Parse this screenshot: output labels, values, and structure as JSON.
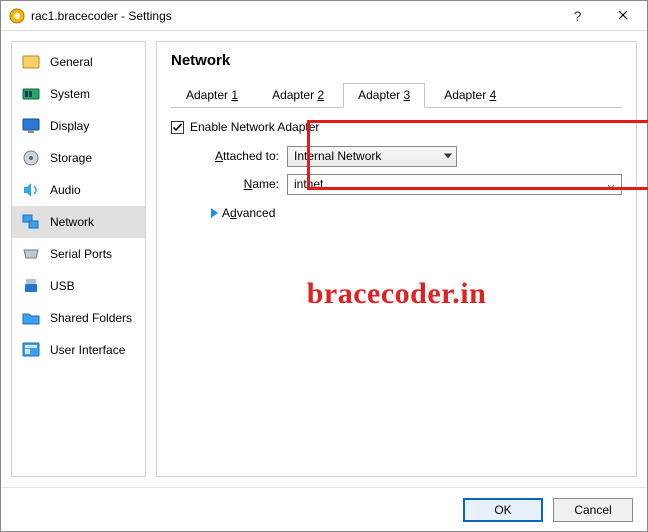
{
  "window": {
    "title": "rac1.bracecoder - Settings",
    "help_tooltip": "?",
    "close_tooltip": "×"
  },
  "sidebar": {
    "items": [
      {
        "label": "General"
      },
      {
        "label": "System"
      },
      {
        "label": "Display"
      },
      {
        "label": "Storage"
      },
      {
        "label": "Audio"
      },
      {
        "label": "Network"
      },
      {
        "label": "Serial Ports"
      },
      {
        "label": "USB"
      },
      {
        "label": "Shared Folders"
      },
      {
        "label": "User Interface"
      }
    ]
  },
  "content": {
    "heading": "Network",
    "tabs": [
      {
        "prefix": "Adapter ",
        "num": "1"
      },
      {
        "prefix": "Adapter ",
        "num": "2"
      },
      {
        "prefix": "Adapter ",
        "num": "3"
      },
      {
        "prefix": "Adapter ",
        "num": "4"
      }
    ],
    "enable_adapter_label": "Enable Network Adapter",
    "attached_to_label": "Attached to:",
    "attached_to_value": "Internal Network",
    "name_label": "Name:",
    "name_value": "intnet",
    "advanced_label": "Advanced"
  },
  "watermark": "bracecoder.in",
  "footer": {
    "ok": "OK",
    "cancel": "Cancel"
  }
}
